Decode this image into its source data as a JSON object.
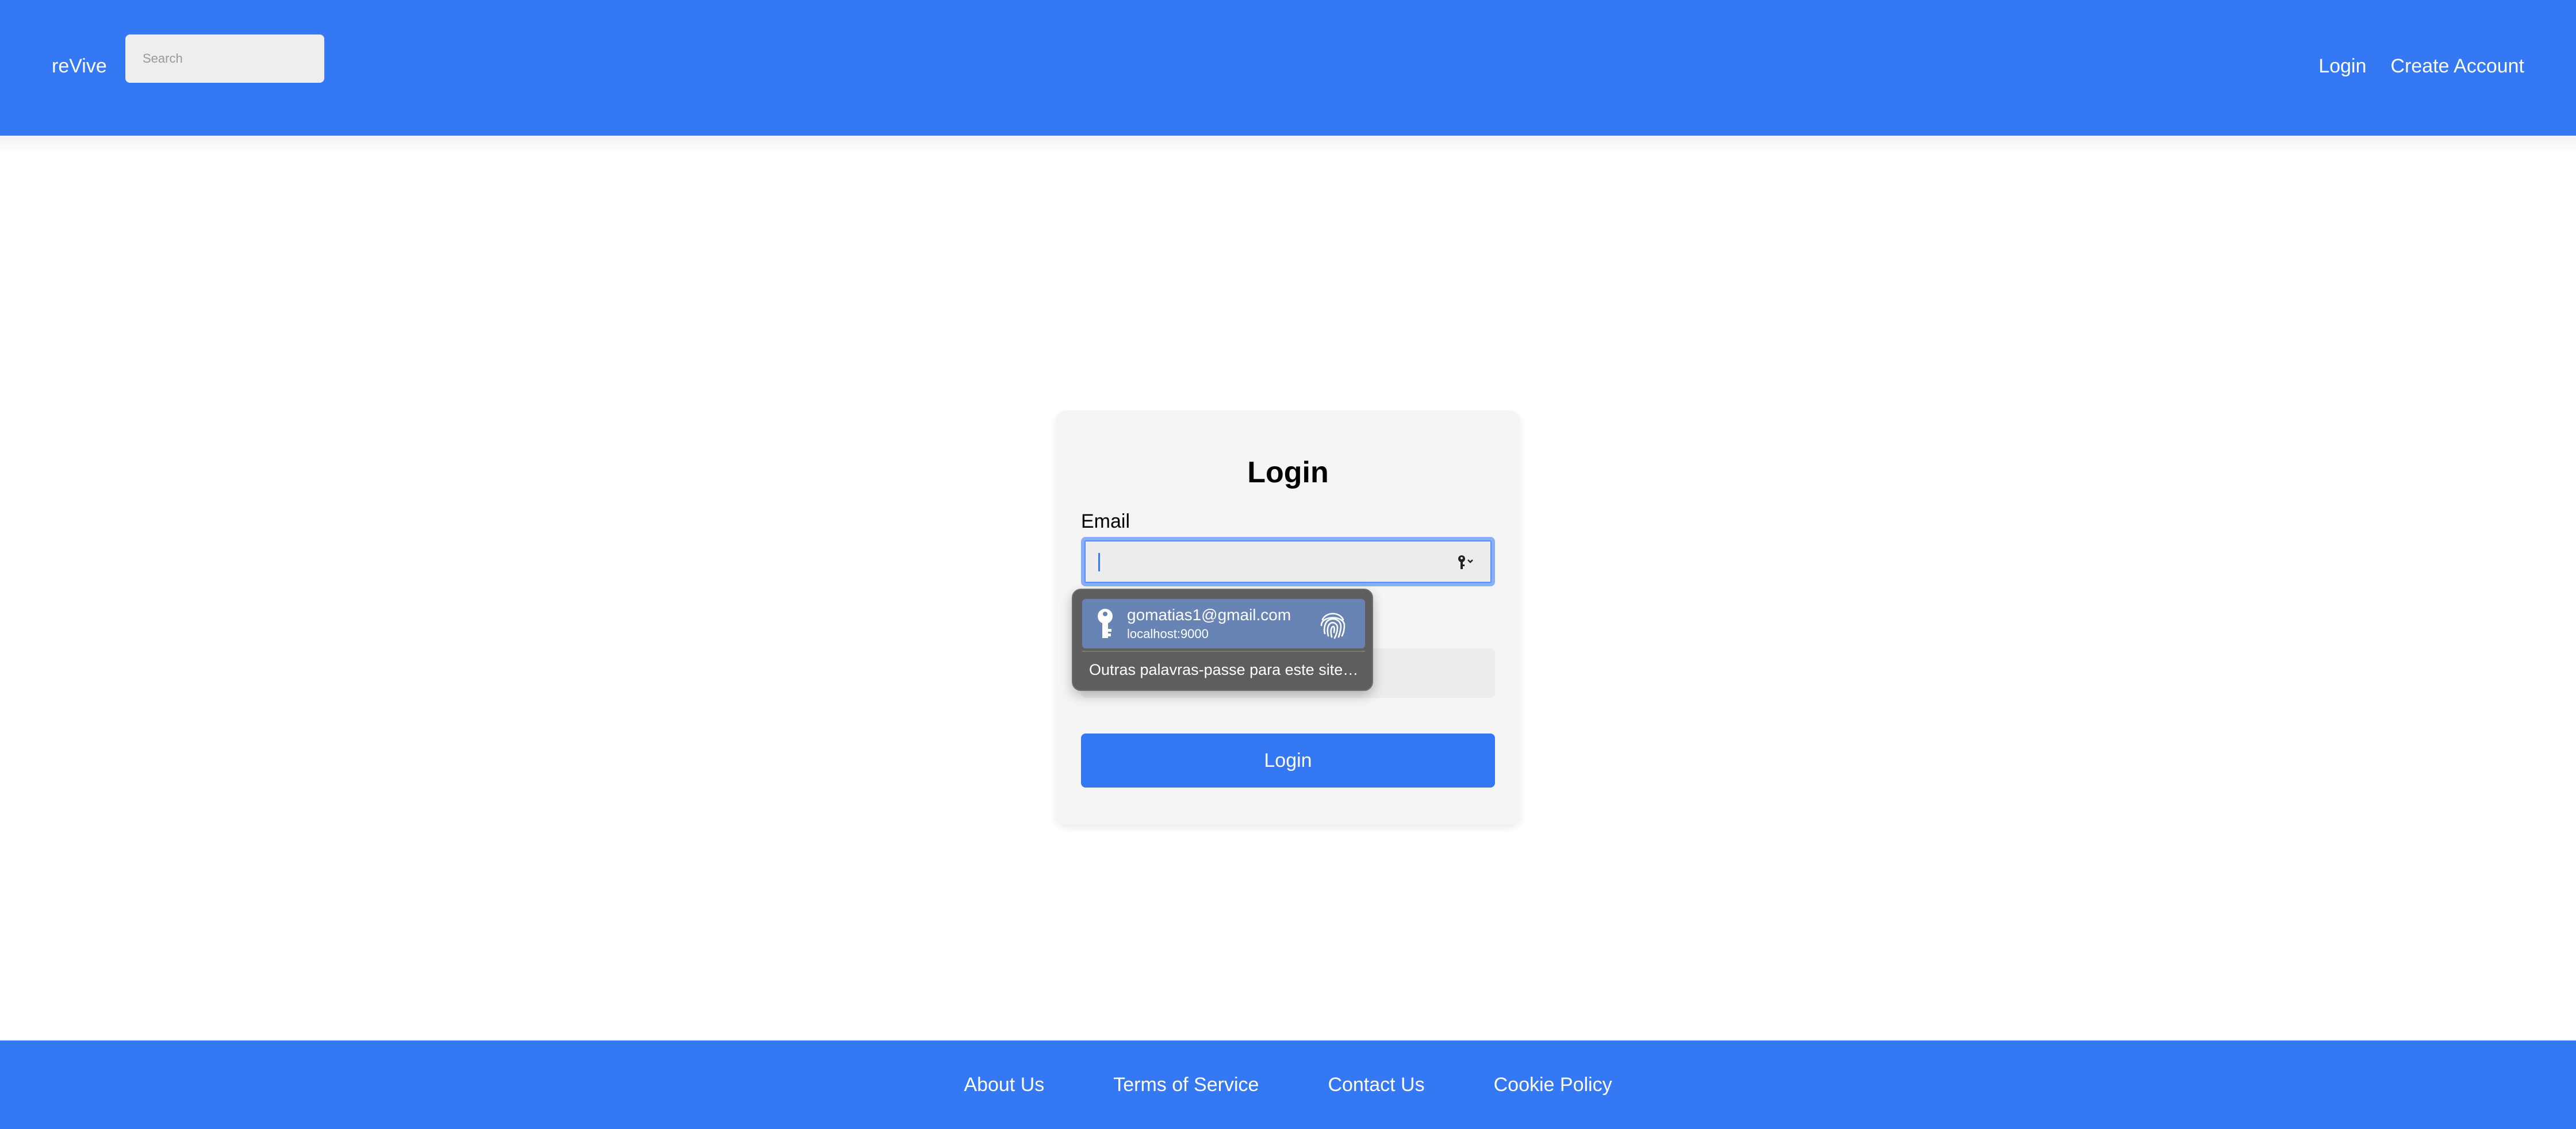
{
  "header": {
    "brand": "reVive",
    "search_placeholder": "Search",
    "nav": {
      "login": "Login",
      "create_account": "Create Account"
    }
  },
  "login_form": {
    "title": "Login",
    "email_label": "Email",
    "email_value": "",
    "password_value": "",
    "submit_label": "Login"
  },
  "autofill_popup": {
    "suggestion_email": "gomatias1@gmail.com",
    "suggestion_host": "localhost:9000",
    "other_passwords": "Outras palavras-passe para este site…"
  },
  "footer": {
    "links": [
      "About Us",
      "Terms of Service",
      "Contact Us",
      "Cookie Policy"
    ]
  },
  "colors": {
    "brand_blue": "#3578f3",
    "card_bg": "#f5f5f5",
    "focus_ring": "#8aaff7",
    "autofill_bg": "#5e5e5e",
    "autofill_selected": "#6784b4"
  },
  "icons": [
    "key-icon",
    "chevron-down-icon",
    "fingerprint-icon"
  ]
}
